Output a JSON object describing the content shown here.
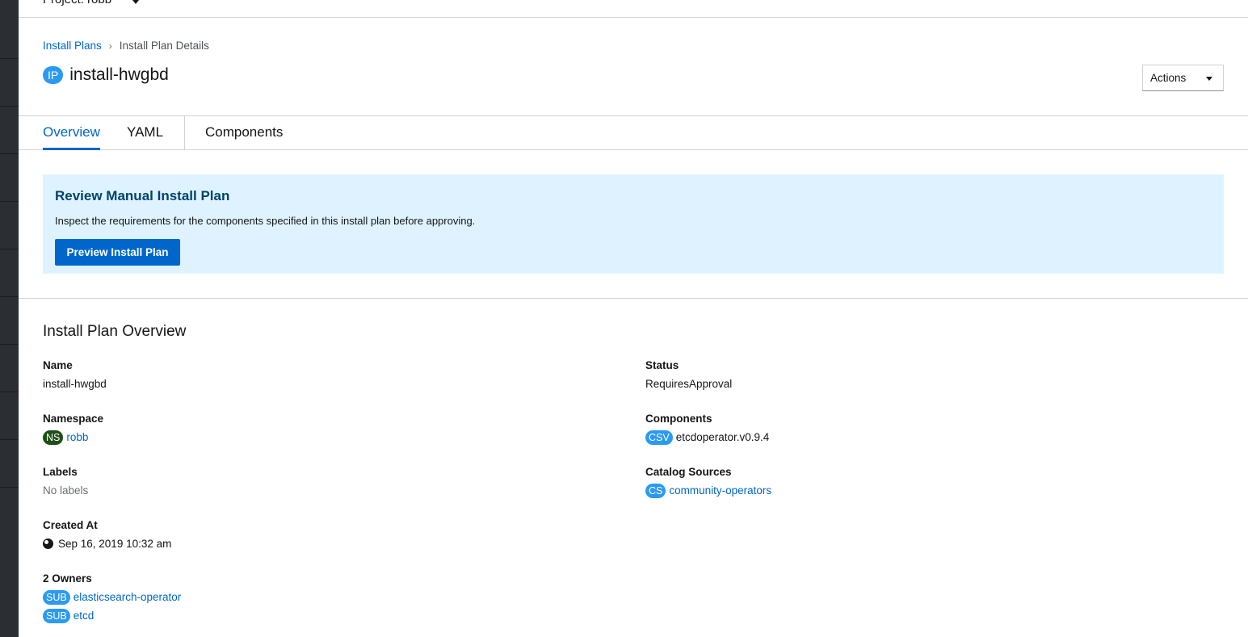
{
  "project": {
    "label": "Project: robb"
  },
  "breadcrumb": {
    "parent": "Install Plans",
    "current": "Install Plan Details"
  },
  "header": {
    "badge": "IP",
    "title": "install-hwgbd",
    "actions_label": "Actions"
  },
  "tabs": [
    {
      "label": "Overview"
    },
    {
      "label": "YAML"
    },
    {
      "label": "Components"
    }
  ],
  "alert": {
    "title": "Review Manual Install Plan",
    "text": "Inspect the requirements for the components specified in this install plan before approving.",
    "button_label": "Preview Install Plan"
  },
  "overview": {
    "title": "Install Plan Overview",
    "name": {
      "label": "Name",
      "value": "install-hwgbd"
    },
    "namespace": {
      "label": "Namespace",
      "badge": "NS",
      "value": "robb"
    },
    "labels": {
      "label": "Labels",
      "value": "No labels"
    },
    "created_at": {
      "label": "Created At",
      "value": "Sep 16, 2019 10:32 am"
    },
    "owners": {
      "label": "2 Owners",
      "items": [
        {
          "badge": "SUB",
          "value": "elasticsearch-operator"
        },
        {
          "badge": "SUB",
          "value": "etcd"
        }
      ]
    },
    "status": {
      "label": "Status",
      "value": "RequiresApproval"
    },
    "components": {
      "label": "Components",
      "badge": "CSV",
      "value": "etcdoperator.v0.9.4"
    },
    "catalog_sources": {
      "label": "Catalog Sources",
      "badge": "CS",
      "value": "community-operators"
    }
  },
  "colors": {
    "accent": "#0066cc",
    "alert_bg": "#def3ff",
    "badge_blue": "#2b9af3",
    "badge_green": "#1e4f18",
    "sidebar": "#2b2f33"
  }
}
